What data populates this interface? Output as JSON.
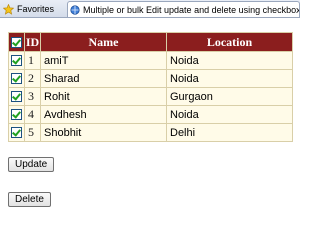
{
  "tabs": {
    "favorites": "Favorites",
    "page_title": "Multiple or bulk Edit update and delete using checkbox..."
  },
  "grid": {
    "headers": {
      "id": "ID",
      "name": "Name",
      "location": "Location"
    },
    "rows": [
      {
        "id": "1",
        "name": "amiT",
        "location": "Noida",
        "checked": true
      },
      {
        "id": "2",
        "name": "Sharad",
        "location": "Noida",
        "checked": true
      },
      {
        "id": "3",
        "name": "Rohit",
        "location": "Gurgaon",
        "checked": true
      },
      {
        "id": "4",
        "name": "Avdhesh",
        "location": "Noida",
        "checked": true
      },
      {
        "id": "5",
        "name": "Shobhit",
        "location": "Delhi",
        "checked": true
      }
    ]
  },
  "buttons": {
    "update": "Update",
    "delete": "Delete"
  },
  "colors": {
    "header_bg": "#8b1e1e",
    "row_bg": "#fffbe8",
    "check": "#21a121"
  }
}
